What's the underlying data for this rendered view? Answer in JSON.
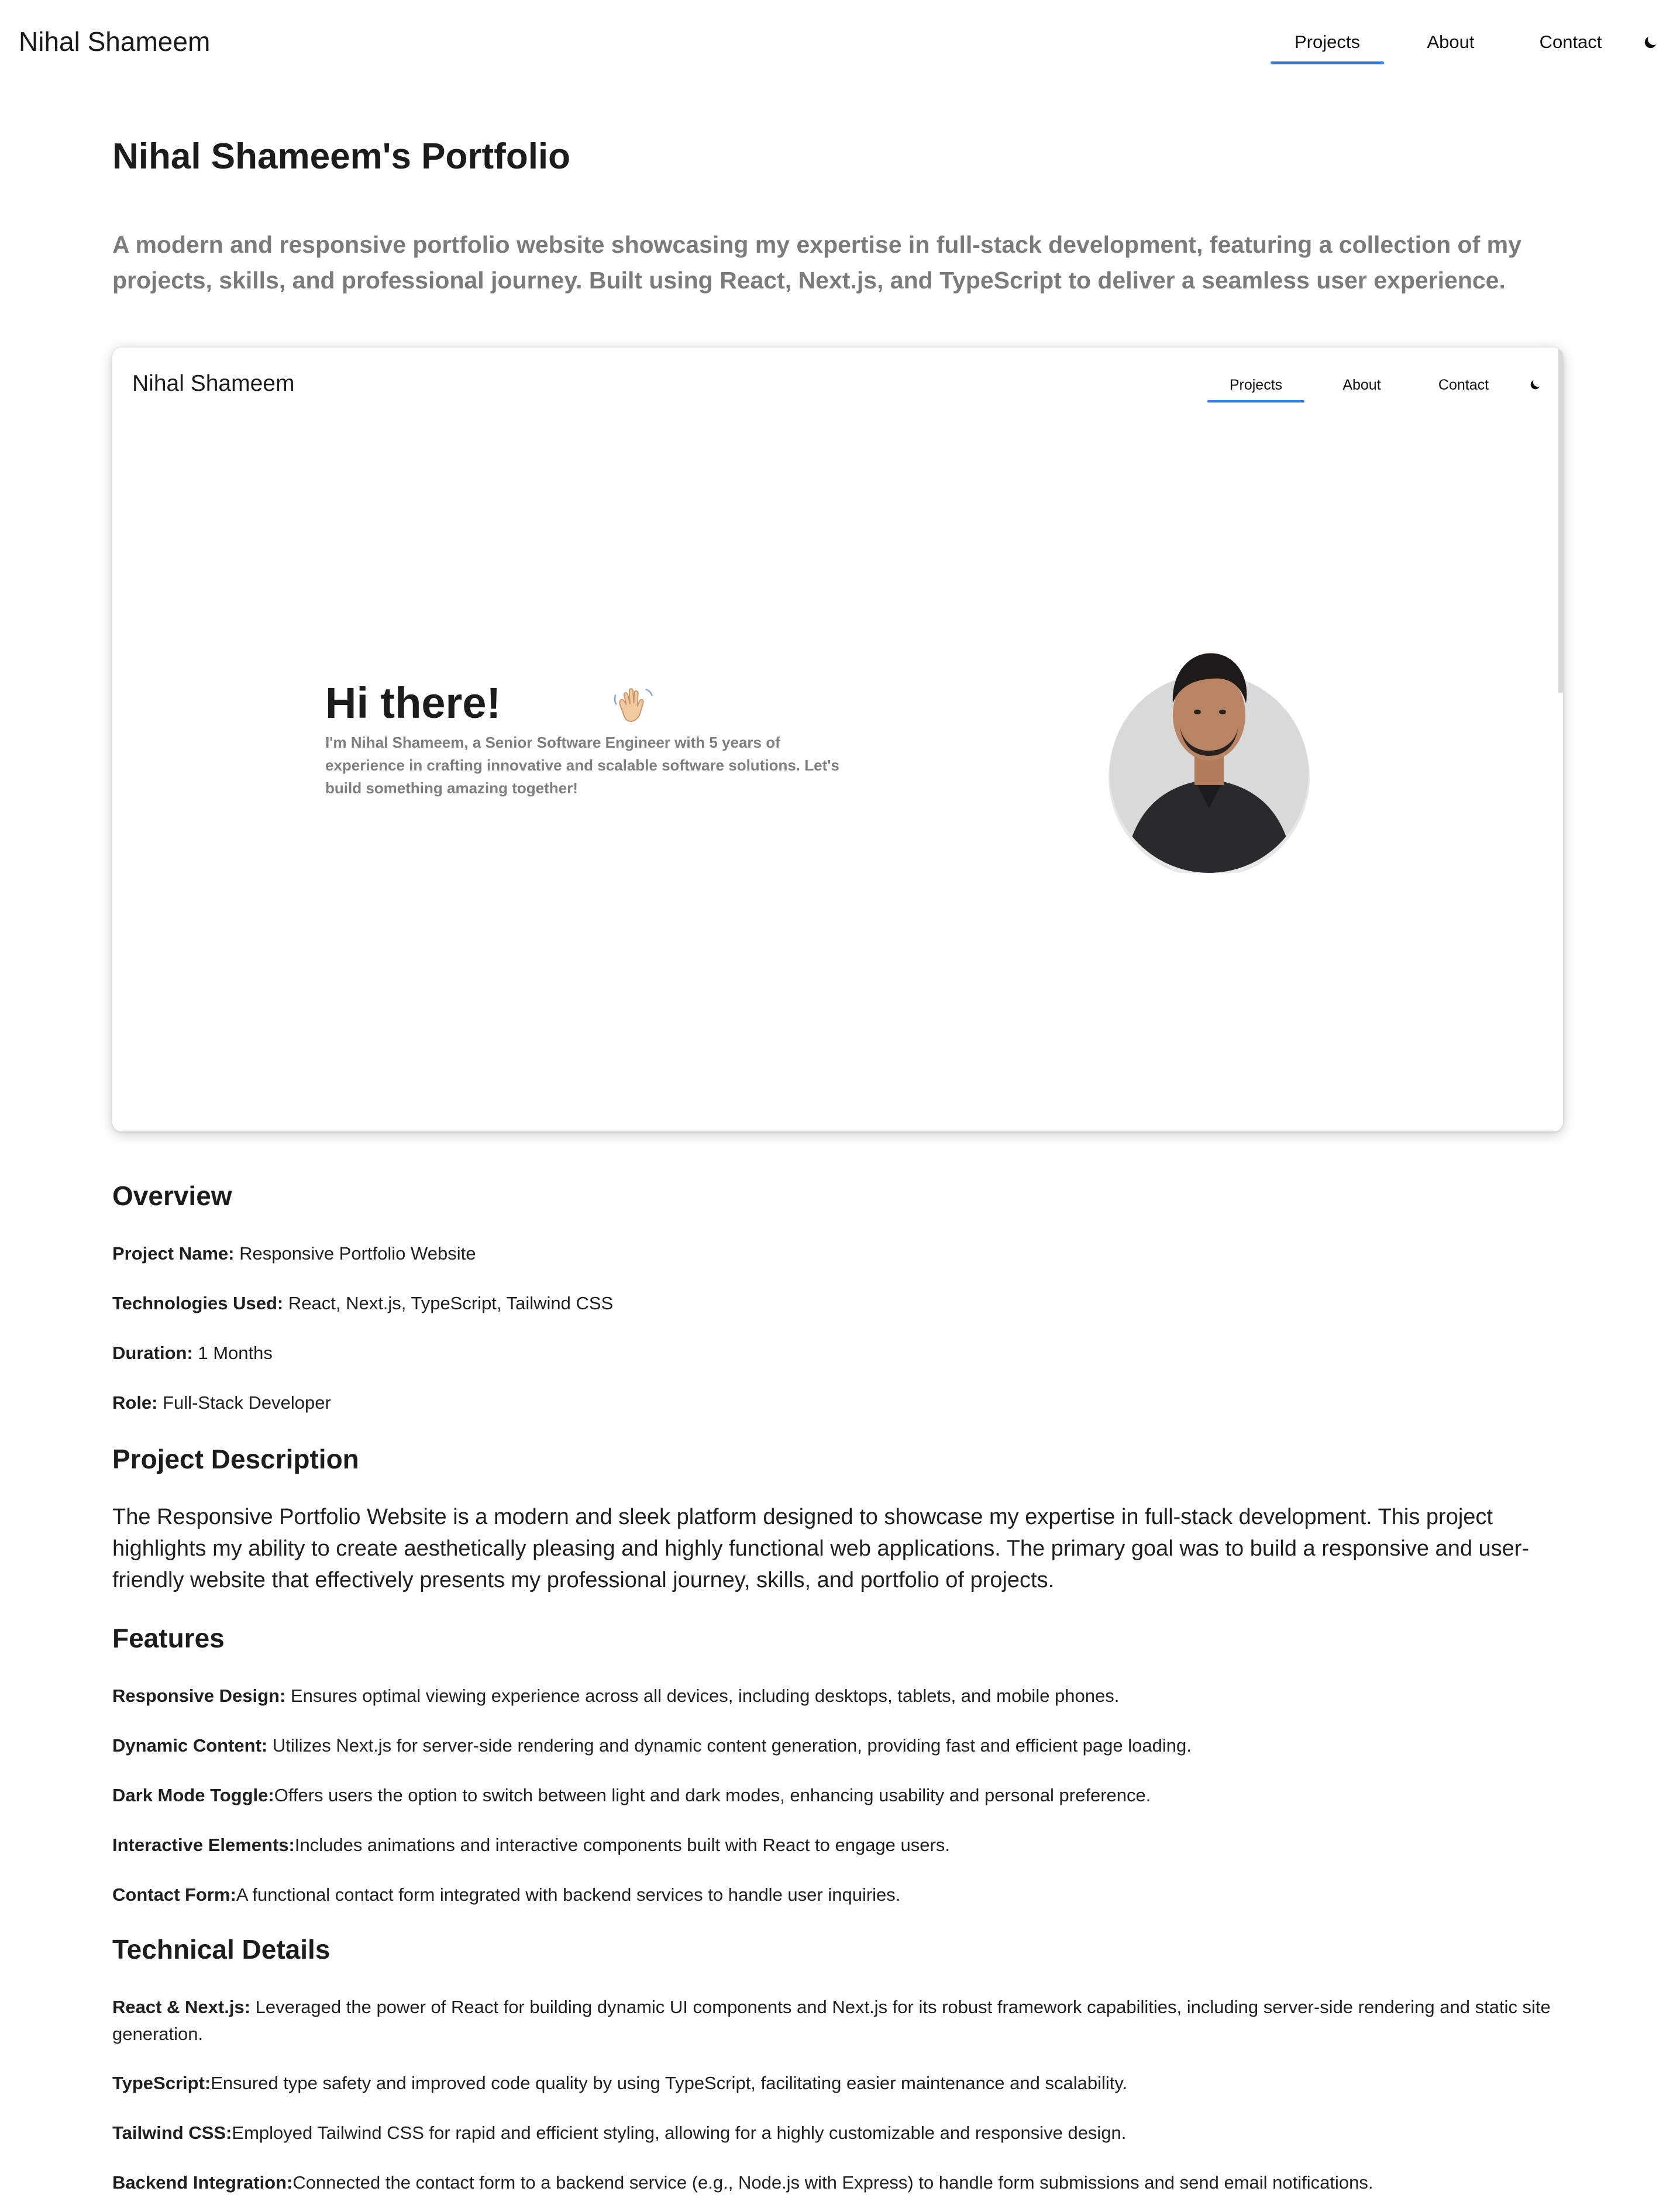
{
  "header": {
    "brand": "Nihal Shameem",
    "nav": [
      {
        "label": "Projects",
        "active": true
      },
      {
        "label": "About",
        "active": false
      },
      {
        "label": "Contact",
        "active": false
      }
    ],
    "theme_toggle_icon": "moon-icon",
    "accent_color": "#2d7fe0"
  },
  "main": {
    "title": "Nihal Shameem's Portfolio",
    "intro": "A modern and responsive portfolio website showcasing my expertise in full-stack development, featuring a collection of my projects, skills, and professional journey. Built using React, Next.js, and TypeScript to deliver a seamless user experience."
  },
  "preview": {
    "brand": "Nihal Shameem",
    "nav": [
      {
        "label": "Projects",
        "active": true
      },
      {
        "label": "About",
        "active": false
      },
      {
        "label": "Contact",
        "active": false
      }
    ],
    "hero_title": "Hi there!",
    "hero_icon": "waving-hand-icon",
    "hero_text": "I'm Nihal Shameem, a Senior Software Engineer with 5 years of experience in crafting innovative and scalable software solutions. Let's build something amazing together!",
    "avatar_icon": "profile-photo"
  },
  "overview": {
    "heading": "Overview",
    "items": [
      {
        "label": "Project Name:",
        "value": " Responsive Portfolio Website"
      },
      {
        "label": "Technologies Used:",
        "value": " React, Next.js, TypeScript, Tailwind CSS"
      },
      {
        "label": "Duration:",
        "value": " 1 Months"
      },
      {
        "label": "Role:",
        "value": " Full-Stack Developer"
      }
    ]
  },
  "description": {
    "heading": "Project Description",
    "text": "The Responsive Portfolio Website is a modern and sleek platform designed to showcase my expertise in full-stack development. This project highlights my ability to create aesthetically pleasing and highly functional web applications. The primary goal was to build a responsive and user-friendly website that effectively presents my professional journey, skills, and portfolio of projects."
  },
  "features": {
    "heading": "Features",
    "items": [
      {
        "label": "Responsive Design:",
        "value": " Ensures optimal viewing experience across all devices, including desktops, tablets, and mobile phones."
      },
      {
        "label": "Dynamic Content:",
        "value": " Utilizes Next.js for server-side rendering and dynamic content generation, providing fast and efficient page loading."
      },
      {
        "label": "Dark Mode Toggle:",
        "value": "Offers users the option to switch between light and dark modes, enhancing usability and personal preference."
      },
      {
        "label": "Interactive Elements:",
        "value": "Includes animations and interactive components built with React to engage users."
      },
      {
        "label": "Contact Form:",
        "value": "A functional contact form integrated with backend services to handle user inquiries."
      }
    ]
  },
  "technical": {
    "heading": "Technical Details",
    "items": [
      {
        "label": "React & Next.js:",
        "value": " Leveraged the power of React for building dynamic UI components and Next.js for its robust framework capabilities, including server-side rendering and static site generation."
      },
      {
        "label": "TypeScript:",
        "value": "Ensured type safety and improved code quality by using TypeScript, facilitating easier maintenance and scalability."
      },
      {
        "label": "Tailwind CSS:",
        "value": "Employed Tailwind CSS for rapid and efficient styling, allowing for a highly customizable and responsive design."
      },
      {
        "label": "Backend Integration:",
        "value": "Connected the contact form to a backend service (e.g., Node.js with Express) to handle form submissions and send email notifications."
      }
    ]
  }
}
